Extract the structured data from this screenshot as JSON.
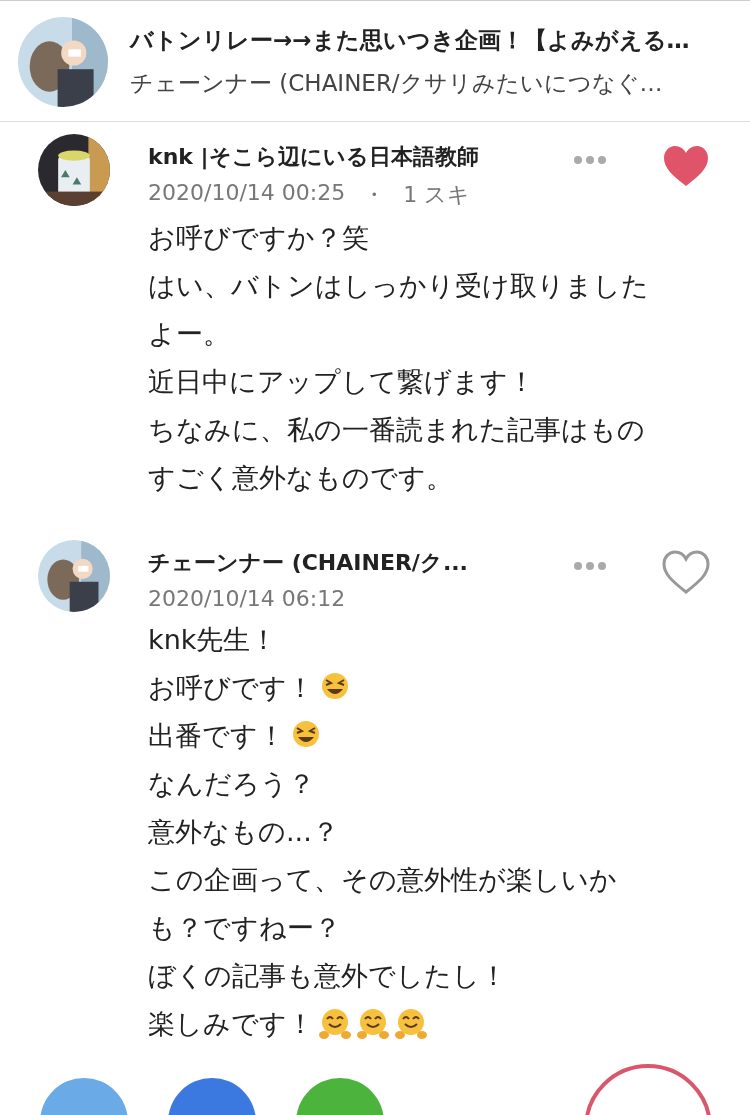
{
  "article": {
    "title": "バトンリレー→→また思いつき企画！【よみがえる…",
    "author": "チェーンナー (CHAINER/クサリみたいにつなぐ…"
  },
  "comments": [
    {
      "author": "knk |そこら辺にいる日本語教師",
      "date": "2020/10/14 00:25",
      "separator": "・",
      "likes": "1 スキ",
      "liked": true,
      "lines": [
        {
          "text": "お呼びですか？笑"
        },
        {
          "text": "はい、バトンはしっかり受け取りました"
        },
        {
          "text": "よー。"
        },
        {
          "text": "近日中にアップして繋げます！"
        },
        {
          "text": "ちなみに、私の一番読まれた記事はもの"
        },
        {
          "text": "すごく意外なものです。"
        }
      ]
    },
    {
      "author": "チェーンナー (CHAINER/ク...",
      "date": "2020/10/14 06:12",
      "liked": false,
      "lines": [
        {
          "text": "knk先生！"
        },
        {
          "text": "お呼びです！",
          "emoji": [
            {
              "kind": "grin"
            }
          ]
        },
        {
          "text": "出番です！",
          "emoji": [
            {
              "kind": "grin"
            }
          ]
        },
        {
          "text": "なんだろう？"
        },
        {
          "text": "意外なもの...？"
        },
        {
          "text": "この企画って、その意外性が楽しいか"
        },
        {
          "text": "も？ですねー？"
        },
        {
          "text": "ぼくの記事も意外でしたし！"
        },
        {
          "text": "楽しみです！",
          "emoji": [
            {
              "kind": "hug"
            },
            {
              "kind": "hug"
            },
            {
              "kind": "hug"
            }
          ]
        }
      ]
    }
  ],
  "share_buttons": [
    {
      "color": "#6aaae6"
    },
    {
      "color": "#3b78e0"
    },
    {
      "color": "#4cb43c"
    }
  ]
}
